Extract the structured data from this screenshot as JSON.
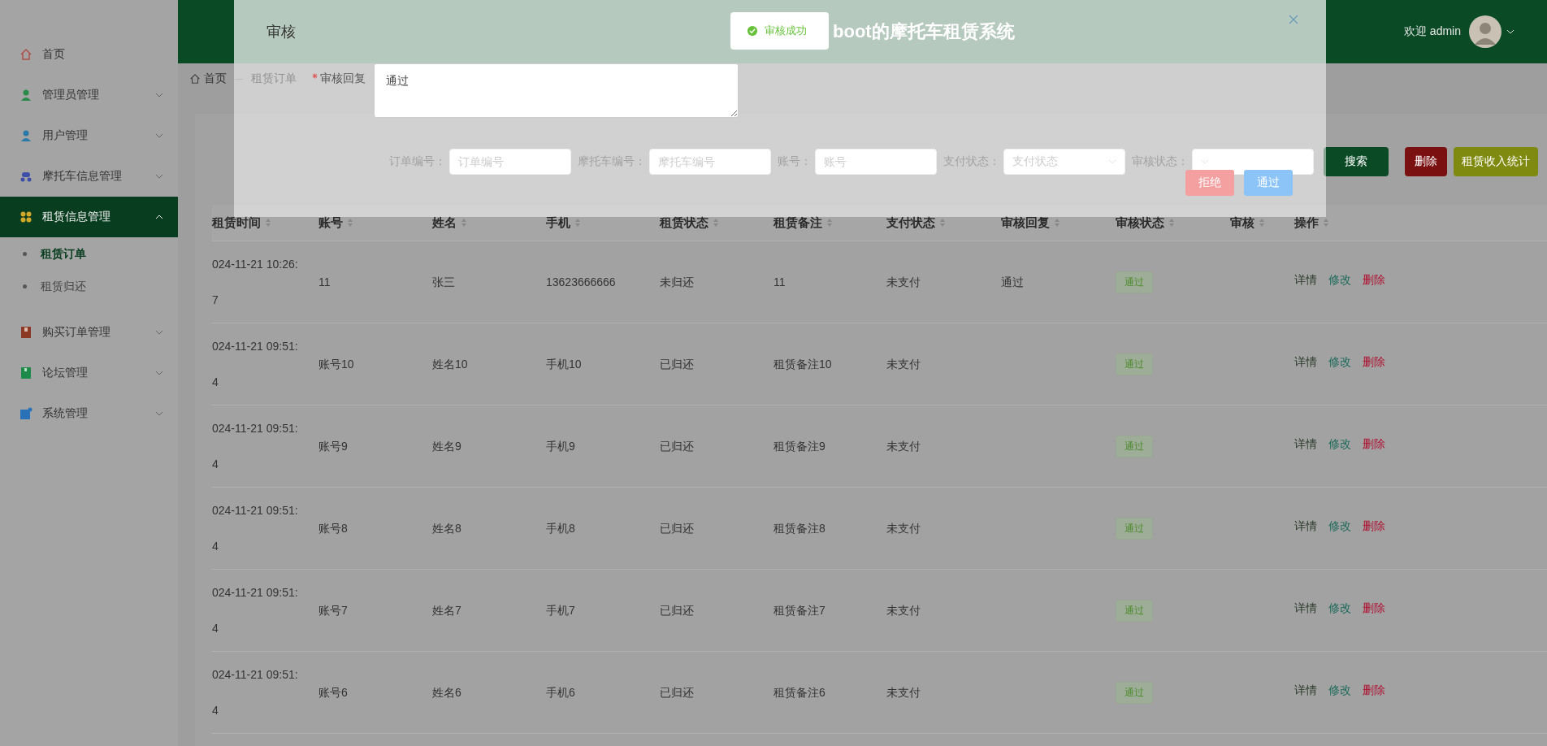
{
  "header": {
    "title": "boot的摩托车租赁系统",
    "welcome": "欢迎 admin"
  },
  "sidebar": {
    "items": [
      {
        "label": "首页",
        "kind": "link",
        "selected": false
      },
      {
        "label": "管理员管理",
        "kind": "menu",
        "selected": false,
        "expanded": false
      },
      {
        "label": "用户管理",
        "kind": "menu",
        "selected": false,
        "expanded": false
      },
      {
        "label": "摩托车信息管理",
        "kind": "menu",
        "selected": false,
        "expanded": false
      },
      {
        "label": "租赁信息管理",
        "kind": "menu",
        "selected": true,
        "expanded": true,
        "children": [
          {
            "label": "租赁订单",
            "selected": true
          },
          {
            "label": "租赁归还",
            "selected": false
          }
        ]
      },
      {
        "label": "购买订单管理",
        "kind": "menu",
        "selected": false,
        "expanded": false
      },
      {
        "label": "论坛管理",
        "kind": "menu",
        "selected": false,
        "expanded": false
      },
      {
        "label": "系统管理",
        "kind": "menu",
        "selected": false,
        "expanded": false
      }
    ]
  },
  "breadcrumb": [
    "首页",
    "租赁订单"
  ],
  "search": {
    "fields": [
      {
        "label": "订单编号：",
        "kind": "input",
        "placeholder": "订单编号"
      },
      {
        "label": "摩托车编号：",
        "kind": "input",
        "placeholder": "摩托车编号"
      },
      {
        "label": "账号：",
        "kind": "input",
        "placeholder": "账号"
      },
      {
        "label": "支付状态：",
        "kind": "select",
        "placeholder": "支付状态"
      },
      {
        "label": "审核状态：",
        "kind": "select"
      }
    ],
    "buttons": [
      {
        "label": "搜索",
        "kind": "search"
      },
      {
        "label": "删除",
        "kind": "delete"
      },
      {
        "label": "租赁收入统计",
        "kind": "stats"
      }
    ]
  },
  "table": {
    "columns": [
      {
        "label": "租赁时间",
        "sortable": true,
        "kind": "text"
      },
      {
        "label": "账号",
        "sortable": true,
        "kind": "text"
      },
      {
        "label": "姓名",
        "sortable": true,
        "kind": "text"
      },
      {
        "label": "手机",
        "sortable": true,
        "kind": "text"
      },
      {
        "label": "租赁状态",
        "sortable": true,
        "kind": "text"
      },
      {
        "label": "租赁备注",
        "sortable": true,
        "kind": "text"
      },
      {
        "label": "支付状态",
        "sortable": true,
        "kind": "text"
      },
      {
        "label": "审核回复",
        "sortable": true,
        "kind": "text"
      },
      {
        "label": "审核状态",
        "sortable": true,
        "kind": "tag"
      },
      {
        "label": "审核",
        "sortable": true,
        "kind": "text"
      },
      {
        "label": "操作",
        "sortable": true,
        "kind": "actions"
      }
    ],
    "rows": [
      {
        "cells": [
          "024-11-21 10:26:\n7",
          "11",
          "张三",
          "13623666666",
          "未归还",
          "11",
          "未支付",
          "通过",
          "通过",
          ""
        ],
        "actions": [
          {
            "label": "详情",
            "kind": "detail"
          },
          {
            "label": "修改",
            "kind": "edit"
          },
          {
            "label": "删除",
            "kind": "delete"
          }
        ]
      },
      {
        "cells": [
          "024-11-21 09:51:\n4",
          "账号10",
          "姓名10",
          "手机10",
          "已归还",
          "租赁备注10",
          "未支付",
          "",
          "通过",
          ""
        ],
        "actions": [
          {
            "label": "详情",
            "kind": "detail"
          },
          {
            "label": "修改",
            "kind": "edit"
          },
          {
            "label": "删除",
            "kind": "delete"
          }
        ]
      },
      {
        "cells": [
          "024-11-21 09:51:\n4",
          "账号9",
          "姓名9",
          "手机9",
          "已归还",
          "租赁备注9",
          "未支付",
          "",
          "通过",
          ""
        ],
        "actions": [
          {
            "label": "详情",
            "kind": "detail"
          },
          {
            "label": "修改",
            "kind": "edit"
          },
          {
            "label": "删除",
            "kind": "delete"
          }
        ]
      },
      {
        "cells": [
          "024-11-21 09:51:\n4",
          "账号8",
          "姓名8",
          "手机8",
          "已归还",
          "租赁备注8",
          "未支付",
          "",
          "通过",
          ""
        ],
        "actions": [
          {
            "label": "详情",
            "kind": "detail"
          },
          {
            "label": "修改",
            "kind": "edit"
          },
          {
            "label": "删除",
            "kind": "delete"
          }
        ]
      },
      {
        "cells": [
          "024-11-21 09:51:\n4",
          "账号7",
          "姓名7",
          "手机7",
          "已归还",
          "租赁备注7",
          "未支付",
          "",
          "通过",
          ""
        ],
        "actions": [
          {
            "label": "详情",
            "kind": "detail"
          },
          {
            "label": "修改",
            "kind": "edit"
          },
          {
            "label": "删除",
            "kind": "delete"
          }
        ]
      },
      {
        "cells": [
          "024-11-21 09:51:\n4",
          "账号6",
          "姓名6",
          "手机6",
          "已归还",
          "租赁备注6",
          "未支付",
          "",
          "通过",
          ""
        ],
        "actions": [
          {
            "label": "详情",
            "kind": "detail"
          },
          {
            "label": "修改",
            "kind": "edit"
          },
          {
            "label": "删除",
            "kind": "delete"
          }
        ]
      }
    ]
  },
  "dialog": {
    "title": "审核",
    "field": {
      "label": "审核回复",
      "required": true,
      "value": "通过"
    },
    "buttons": [
      {
        "label": "拒绝",
        "kind": "danger"
      },
      {
        "label": "通过",
        "kind": "primary"
      }
    ]
  },
  "toast": {
    "message": "审核成功",
    "kind": "success"
  }
}
